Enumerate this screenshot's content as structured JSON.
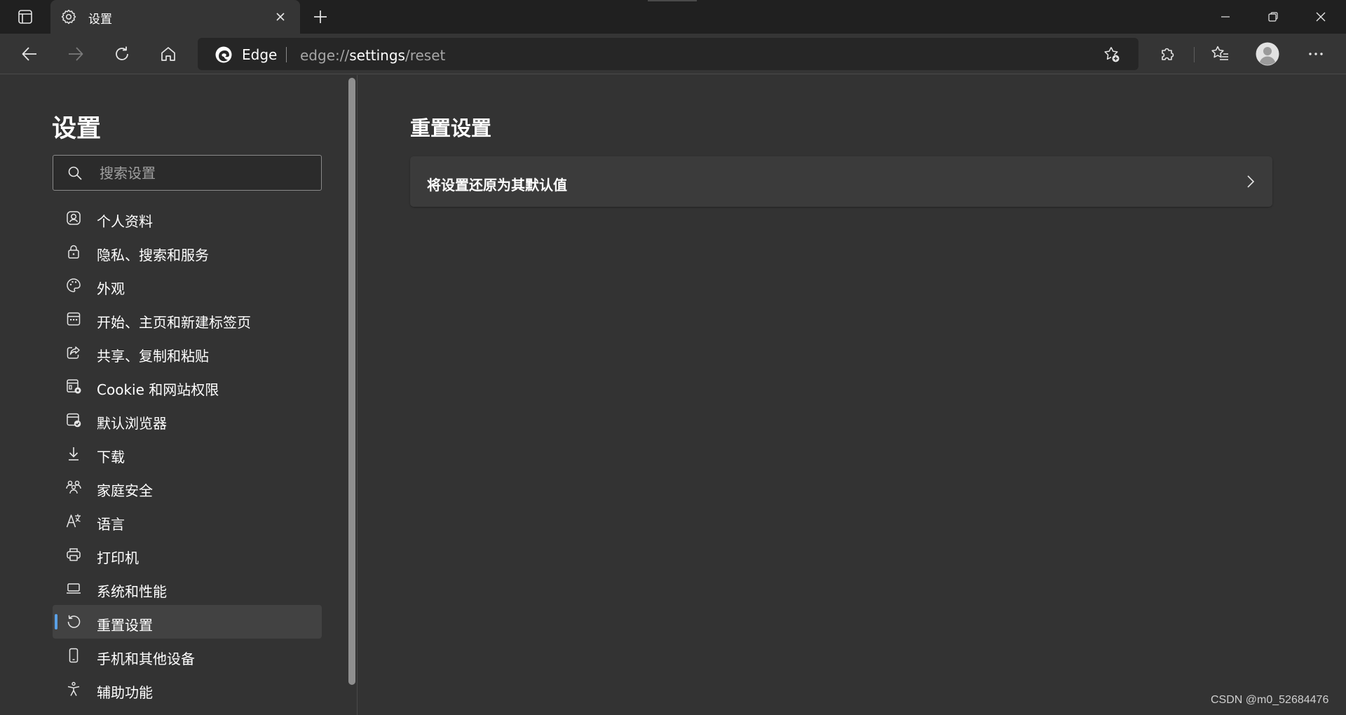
{
  "tab": {
    "title": "设置"
  },
  "address": {
    "site_name": "Edge",
    "url_prefix": "edge://",
    "url_strong": "settings",
    "url_suffix": "/reset"
  },
  "sidebar": {
    "title": "设置",
    "search_placeholder": "搜索设置",
    "items": [
      {
        "label": "个人资料",
        "icon": "profile-icon"
      },
      {
        "label": "隐私、搜索和服务",
        "icon": "lock-icon"
      },
      {
        "label": "外观",
        "icon": "palette-icon"
      },
      {
        "label": "开始、主页和新建标签页",
        "icon": "start-page-icon"
      },
      {
        "label": "共享、复制和粘贴",
        "icon": "share-icon"
      },
      {
        "label": "Cookie 和网站权限",
        "icon": "site-permissions-icon"
      },
      {
        "label": "默认浏览器",
        "icon": "default-browser-icon"
      },
      {
        "label": "下载",
        "icon": "download-icon"
      },
      {
        "label": "家庭安全",
        "icon": "family-icon"
      },
      {
        "label": "语言",
        "icon": "language-icon"
      },
      {
        "label": "打印机",
        "icon": "printer-icon"
      },
      {
        "label": "系统和性能",
        "icon": "laptop-icon"
      },
      {
        "label": "重置设置",
        "icon": "reset-icon",
        "selected": true
      },
      {
        "label": "手机和其他设备",
        "icon": "phone-icon"
      },
      {
        "label": "辅助功能",
        "icon": "accessibility-icon"
      }
    ]
  },
  "main": {
    "title": "重置设置",
    "reset_card_label": "将设置还原为其默认值"
  },
  "watermark": "CSDN @m0_52684476",
  "colors": {
    "accent": "#5aa0e6",
    "tabbar_bg": "#202020",
    "toolbar_bg": "#353535",
    "page_bg": "#333333",
    "card_bg": "#3b3b3b"
  }
}
